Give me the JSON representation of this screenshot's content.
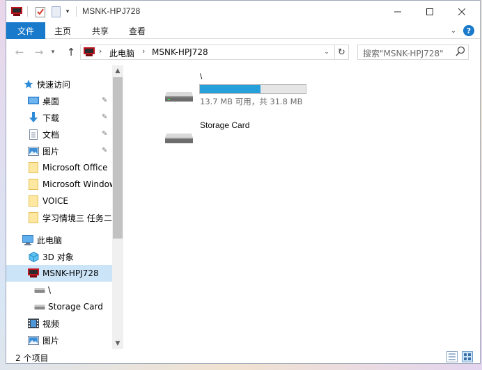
{
  "window": {
    "title": "MSNK-HPJ728",
    "controls": {
      "minimize_icon": "minimize-icon",
      "maximize_icon": "maximize-icon",
      "close_icon": "close-icon"
    }
  },
  "ribbon": {
    "tabs": [
      {
        "label": "文件",
        "active": true
      },
      {
        "label": "主页"
      },
      {
        "label": "共享"
      },
      {
        "label": "查看"
      }
    ]
  },
  "address": {
    "crumbs": [
      "此电脑",
      "MSNK-HPJ728"
    ]
  },
  "search": {
    "placeholder": "搜索\"MSNK-HPJ728\""
  },
  "nav": {
    "quick_access": "快速访问",
    "pinned": [
      {
        "label": "桌面",
        "icon": "desktop-icon"
      },
      {
        "label": "下载",
        "icon": "download-icon"
      },
      {
        "label": "文档",
        "icon": "document-icon"
      },
      {
        "label": "图片",
        "icon": "pictures-icon"
      }
    ],
    "recent": [
      {
        "label": "Microsoft Office",
        "icon": "folder-icon"
      },
      {
        "label": "Microsoft Window",
        "icon": "folder-icon"
      },
      {
        "label": "VOICE",
        "icon": "folder-icon"
      },
      {
        "label": "学习情境三 任务二",
        "icon": "folder-icon"
      }
    ],
    "this_pc": "此电脑",
    "pc_items": [
      {
        "label": "3D 对象",
        "icon": "3d-objects-icon"
      },
      {
        "label": "MSNK-HPJ728",
        "icon": "device-icon",
        "selected": true
      },
      {
        "label": "\\",
        "icon": "drive-icon"
      },
      {
        "label": "Storage Card",
        "icon": "drive-icon"
      },
      {
        "label": "视频",
        "icon": "video-icon"
      },
      {
        "label": "图片",
        "icon": "pictures-icon"
      }
    ]
  },
  "content": {
    "drives": [
      {
        "name": "\\",
        "used_fraction": 0.57,
        "usage_text": "13.7 MB 可用，共 31.8 MB"
      },
      {
        "name": "Storage Card"
      }
    ]
  },
  "status": {
    "item_count": "2 个项目"
  },
  "colors": {
    "accent": "#1979ca",
    "usage_fill": "#26a0da",
    "selection": "#cce4f7"
  }
}
